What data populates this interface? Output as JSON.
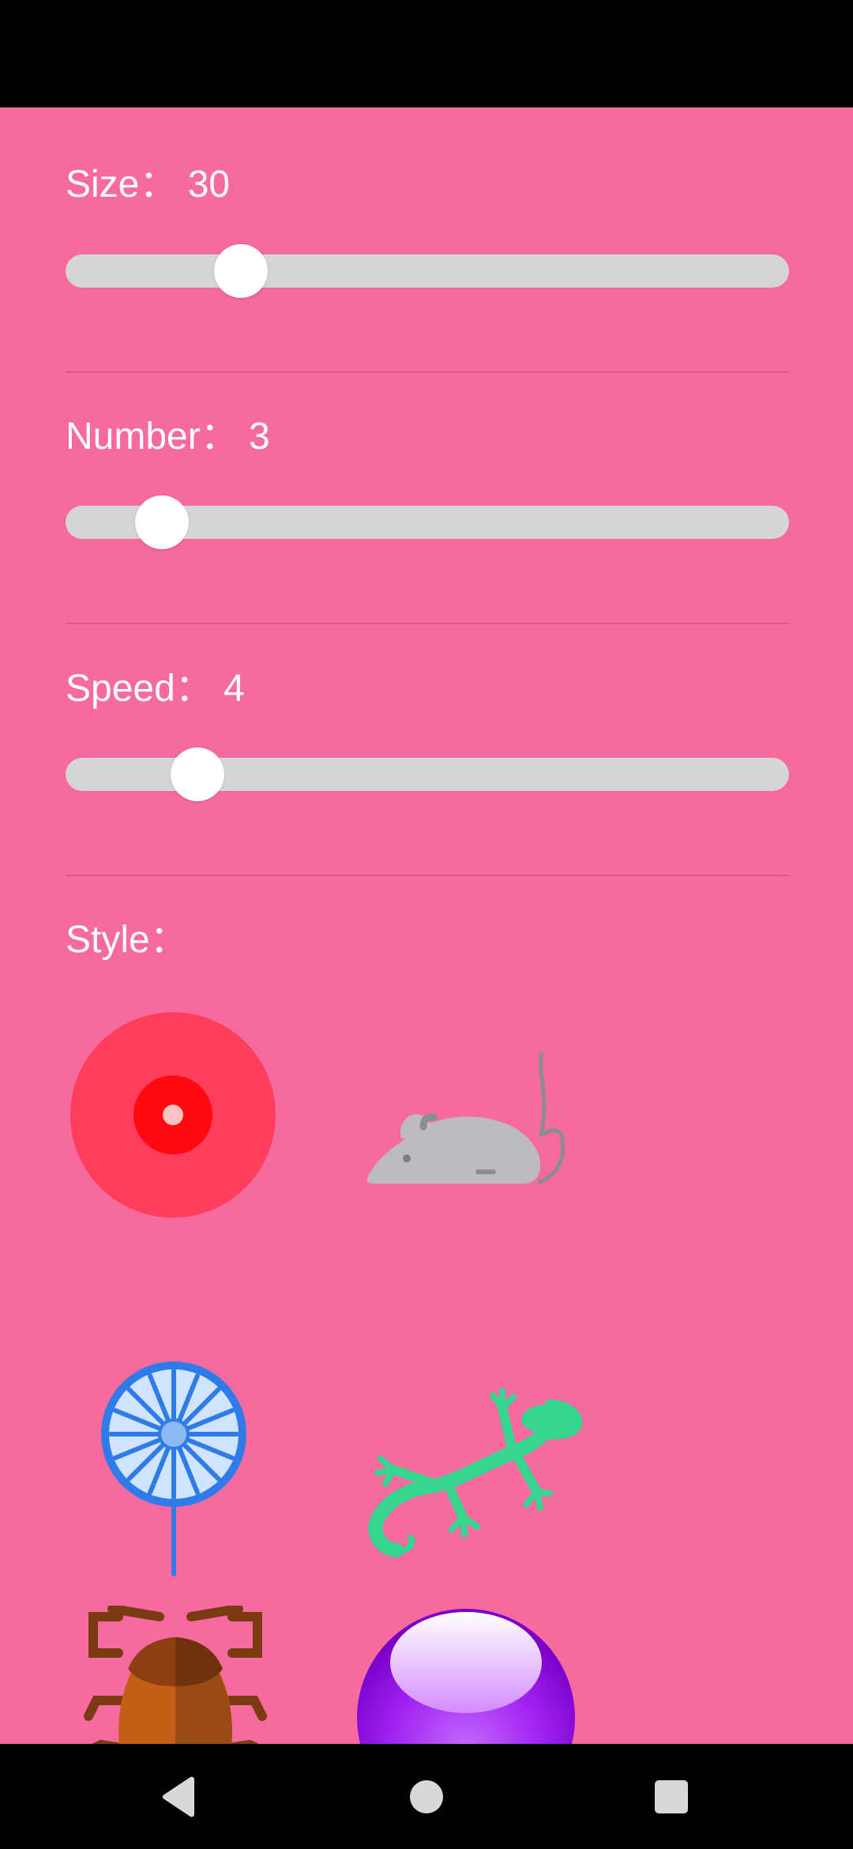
{
  "settings": {
    "size": {
      "label": "Size： 30",
      "value": 30,
      "fraction": 0.242
    },
    "number": {
      "label": "Number： 3",
      "value": 3,
      "fraction": 0.133
    },
    "speed": {
      "label": "Speed： 4",
      "value": 4,
      "fraction": 0.182
    },
    "style": {
      "label": "Style："
    }
  },
  "style_options": [
    {
      "name": "laser-dot-icon"
    },
    {
      "name": "mouse-icon"
    },
    {
      "name": "dandelion-icon"
    },
    {
      "name": "gecko-icon"
    },
    {
      "name": "cockroach-icon"
    },
    {
      "name": "purple-ball-icon"
    }
  ],
  "colors": {
    "background": "#F76A9F",
    "slider_track": "#D5D5D5",
    "slider_thumb": "#FFFFFF",
    "text": "#FFFFFF"
  },
  "nav": {
    "back": "back-icon",
    "home": "home-icon",
    "recents": "recents-icon"
  }
}
